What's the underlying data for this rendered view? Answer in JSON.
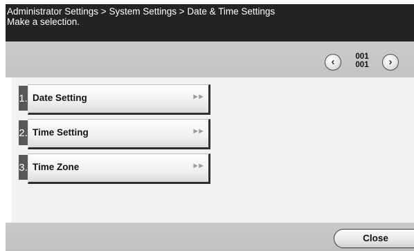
{
  "header": {
    "breadcrumb": "Administrator Settings > System Settings > Date & Time Settings",
    "instruction": "Make a selection."
  },
  "pager": {
    "current_page": "001",
    "total_pages": "001",
    "prev_icon": "chevron-left-icon",
    "next_icon": "chevron-right-icon"
  },
  "menu": {
    "items": [
      {
        "number": "1.",
        "label": "Date Setting",
        "arrow_icon": "double-arrow-right-icon"
      },
      {
        "number": "2.",
        "label": "Time Setting",
        "arrow_icon": "double-arrow-right-icon"
      },
      {
        "number": "3.",
        "label": "Time Zone",
        "arrow_icon": "double-arrow-right-icon"
      }
    ]
  },
  "footer": {
    "close_label": "Close"
  }
}
